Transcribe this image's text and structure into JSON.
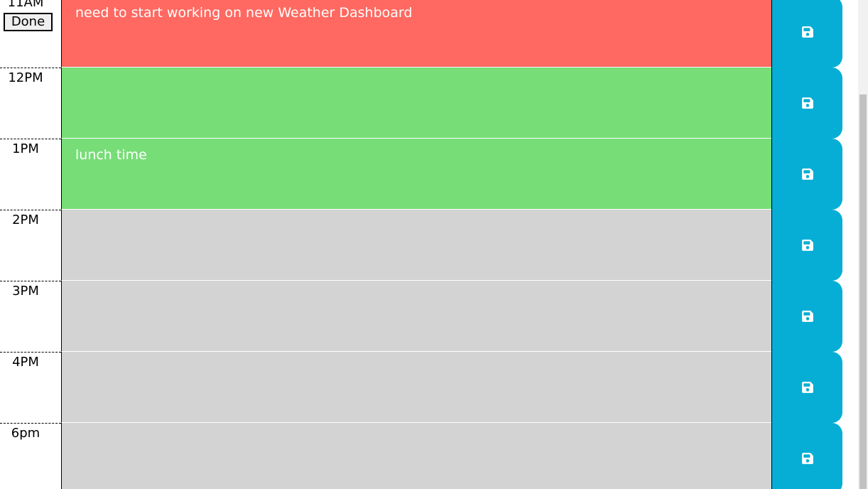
{
  "planner": {
    "rows": [
      {
        "hour": "11AM",
        "text": "need to start working on new Weather Dashboard",
        "status": "past",
        "extra_button": "Done"
      },
      {
        "hour": "12PM",
        "text": "",
        "status": "present"
      },
      {
        "hour": "1PM",
        "text": "lunch time",
        "status": "present"
      },
      {
        "hour": "2PM",
        "text": "",
        "status": "future"
      },
      {
        "hour": "3PM",
        "text": "",
        "status": "future"
      },
      {
        "hour": "4PM",
        "text": "",
        "status": "future"
      },
      {
        "hour": "6pm",
        "text": "",
        "status": "future"
      }
    ],
    "save_icon": "floppy-disk-icon"
  },
  "colors": {
    "past": "#ff6961",
    "present": "#77dd77",
    "future": "#d3d3d3",
    "save_button": "#06aed5"
  }
}
